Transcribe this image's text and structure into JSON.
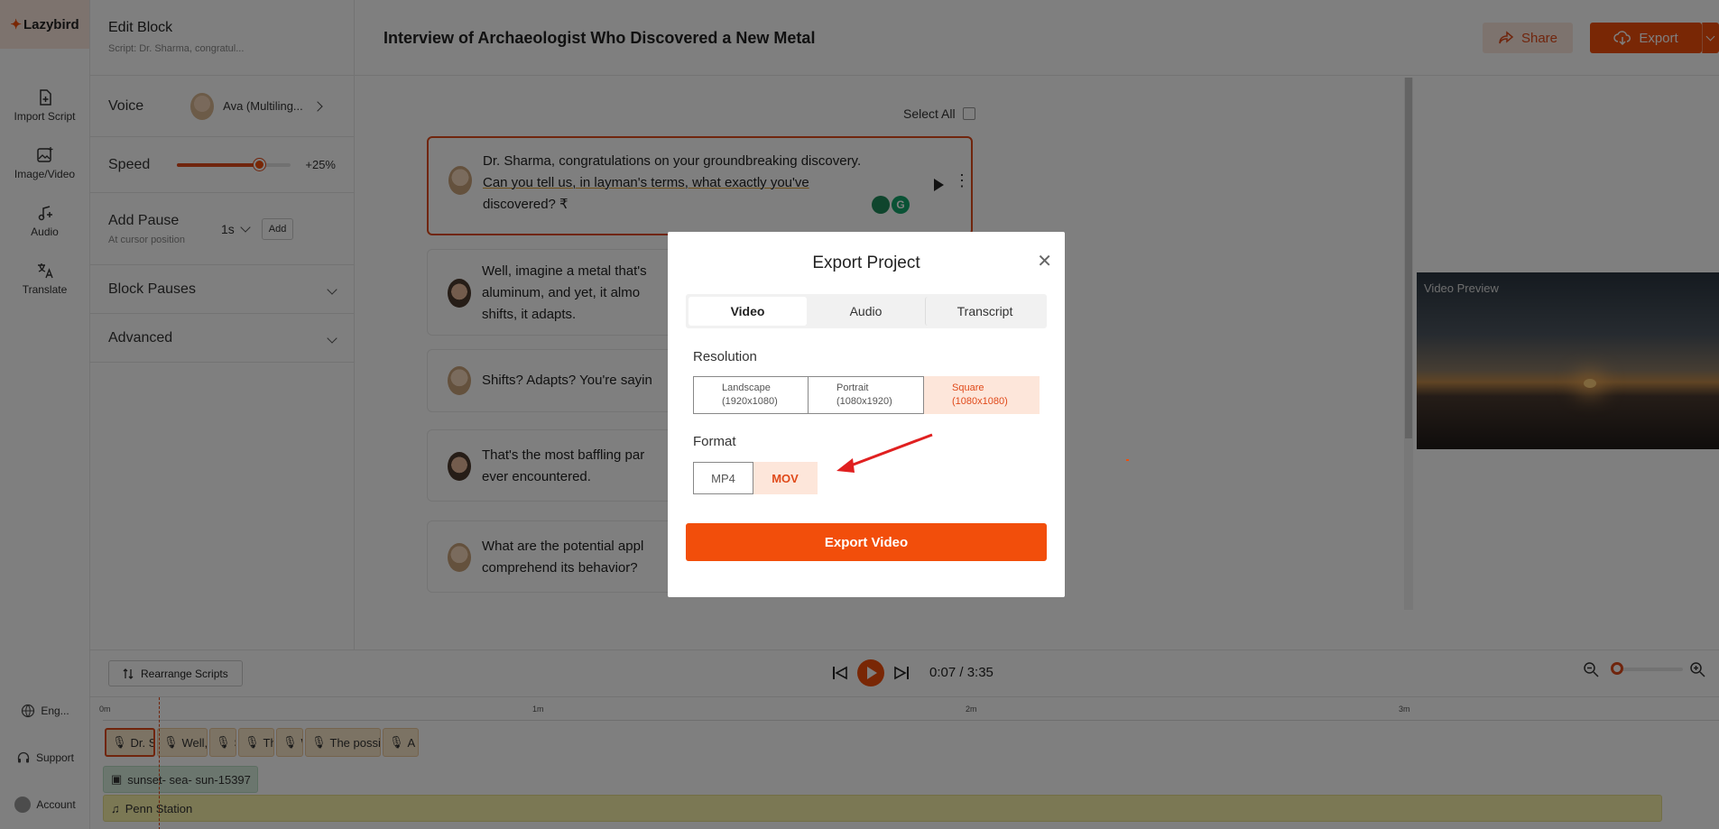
{
  "app": {
    "logo_text": "Lazybird"
  },
  "rail": {
    "items": [
      {
        "label": "Import Script",
        "icon": "file-plus-icon"
      },
      {
        "label": "Image/Video",
        "icon": "image-plus-icon"
      },
      {
        "label": "Audio",
        "icon": "music-plus-icon"
      },
      {
        "label": "Translate",
        "icon": "translate-icon"
      }
    ],
    "language": "Eng...",
    "support": "Support",
    "account": "Account"
  },
  "panel": {
    "title": "Edit Block",
    "subtitle": "Script: Dr. Sharma, congratul...",
    "voice_label": "Voice",
    "voice_name": "Ava (Multiling...",
    "speed_label": "Speed",
    "speed_value": "+25%",
    "speed_level": 0.72,
    "pause_label": "Add Pause",
    "pause_sub": "At cursor position",
    "pause_value": "1s",
    "pause_add": "Add",
    "block_pauses": "Block Pauses",
    "advanced": "Advanced"
  },
  "header": {
    "title": "Interview of Archaeologist Who Discovered a New Metal",
    "share": "Share",
    "export": "Export"
  },
  "script": {
    "select_all": "Select All",
    "blocks": [
      {
        "speaker": "female",
        "lines": [
          "Dr. Sharma, congratulations on your groundbreaking discovery.",
          "Can you tell us, in layman's terms, what exactly you've",
          "discovered? ₹"
        ]
      },
      {
        "speaker": "male",
        "lines": [
          "Well, imagine a metal that's",
          "aluminum, and yet,  it almo",
          "shifts, it adapts."
        ]
      },
      {
        "speaker": "female",
        "lines": [
          "Shifts? Adapts? You're sayin"
        ]
      },
      {
        "speaker": "male",
        "lines": [
          "That's the most baffling par",
          "ever encountered."
        ]
      },
      {
        "speaker": "female",
        "lines": [
          "What are the potential appl",
          "comprehend its behavior?"
        ]
      }
    ]
  },
  "preview": {
    "label": "Video Preview"
  },
  "player": {
    "rearrange": "Rearrange Scripts",
    "time": "0:07 / 3:35"
  },
  "timeline": {
    "ruler": [
      "0m",
      "1m",
      "2m",
      "3m"
    ],
    "segments": [
      "Dr. Sh",
      "Well, in",
      "S",
      "Th",
      "W",
      "The possi",
      "A c"
    ],
    "image_track": "sunset- sea- sun-15397",
    "audio_track": "Penn Station"
  },
  "modal": {
    "title": "Export Project",
    "tabs": [
      "Video",
      "Audio",
      "Transcript"
    ],
    "resolution_label": "Resolution",
    "resolutions": [
      {
        "name": "Landscape",
        "size": "(1920x1080)"
      },
      {
        "name": "Portrait",
        "size": "(1080x1920)"
      },
      {
        "name": "Square",
        "size": "(1080x1080)"
      }
    ],
    "format_label": "Format",
    "formats": [
      "MP4",
      "MOV"
    ],
    "export_button": "Export Video"
  },
  "colors": {
    "accent": "#f24e0b",
    "accent_light": "#fde6da",
    "annotation_arrow": "#e02020"
  }
}
